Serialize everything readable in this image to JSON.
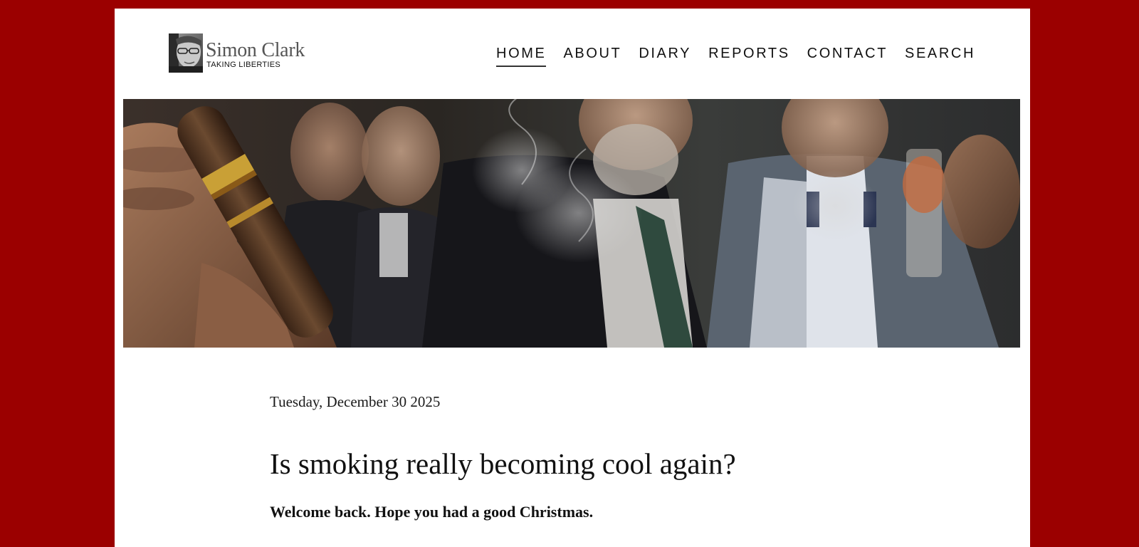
{
  "site": {
    "name": "Simon Clark",
    "tagline": "TAKING LIBERTIES"
  },
  "nav": {
    "items": [
      {
        "label": "HOME",
        "active": true
      },
      {
        "label": "ABOUT",
        "active": false
      },
      {
        "label": "DIARY",
        "active": false
      },
      {
        "label": "REPORTS",
        "active": false
      },
      {
        "label": "CONTACT",
        "active": false
      },
      {
        "label": "SEARCH",
        "active": false
      }
    ]
  },
  "hero": {
    "image": "photo-men-smoking-cigars"
  },
  "post": {
    "date": "Tuesday, December 30 2025",
    "title": "Is smoking really becoming cool again?",
    "lead": "Welcome back. Hope you had a good Christmas."
  },
  "colors": {
    "page_background": "#9b0000",
    "panel_background": "#ffffff",
    "text": "#111111"
  }
}
